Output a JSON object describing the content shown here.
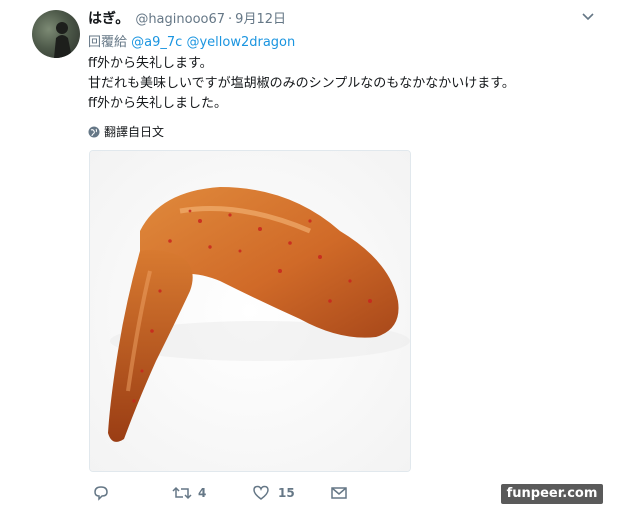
{
  "tweet": {
    "display_name": "はぎ。",
    "handle": "@haginooo67",
    "separator": "·",
    "date": "9月12日",
    "reply_prefix": "回覆給",
    "reply_mentions": [
      "@a9_7c",
      "@yellow2dragon"
    ],
    "body_lines": [
      "ff外から失礼します。",
      "甘だれも美味しいですが塩胡椒のみのシンプルなのもなかなかいけます。",
      "ff外から失礼しました。"
    ],
    "translate_label": "翻譯自日文"
  },
  "actions": {
    "reply_count": "",
    "retweet_count": "4",
    "like_count": "15"
  },
  "watermark": "funpeer.com",
  "colors": {
    "link": "#1b95e0",
    "muted": "#657786",
    "text": "#14171a"
  },
  "icons": [
    "chevron-down-icon",
    "globe-icon",
    "reply-icon",
    "retweet-icon",
    "like-icon",
    "message-icon"
  ]
}
